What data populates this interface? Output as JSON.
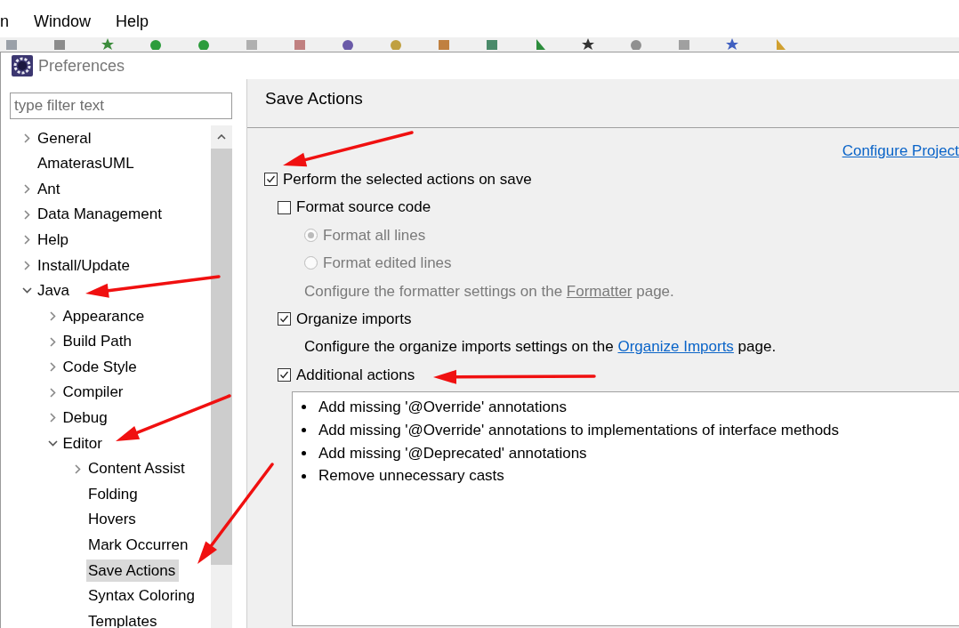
{
  "menu_bar": [
    "n",
    "Window",
    "Help"
  ],
  "dialog": {
    "title": "Preferences"
  },
  "filter": {
    "placeholder": "type filter text"
  },
  "tree": [
    {
      "label": "General",
      "kind": "folder",
      "expanded": false,
      "selected": false
    },
    {
      "label": "AmaterasUML",
      "kind": "leaf",
      "selected": false
    },
    {
      "label": "Ant",
      "kind": "folder",
      "expanded": false,
      "selected": false
    },
    {
      "label": "Data Management",
      "kind": "folder",
      "expanded": false,
      "selected": false
    },
    {
      "label": "Help",
      "kind": "folder",
      "expanded": false,
      "selected": false
    },
    {
      "label": "Install/Update",
      "kind": "folder",
      "expanded": false,
      "selected": false
    },
    {
      "label": "Java",
      "kind": "folder",
      "expanded": true,
      "selected": false,
      "children": [
        {
          "label": "Appearance",
          "kind": "folder",
          "expanded": false,
          "selected": false
        },
        {
          "label": "Build Path",
          "kind": "folder",
          "expanded": false,
          "selected": false
        },
        {
          "label": "Code Style",
          "kind": "folder",
          "expanded": false,
          "selected": false
        },
        {
          "label": "Compiler",
          "kind": "folder",
          "expanded": false,
          "selected": false
        },
        {
          "label": "Debug",
          "kind": "folder",
          "expanded": false,
          "selected": false
        },
        {
          "label": "Editor",
          "kind": "folder",
          "expanded": true,
          "selected": false,
          "children": [
            {
              "label": "Content Assist",
              "kind": "folder",
              "expanded": false,
              "selected": false
            },
            {
              "label": "Folding",
              "kind": "leaf",
              "selected": false
            },
            {
              "label": "Hovers",
              "kind": "leaf",
              "selected": false
            },
            {
              "label": "Mark Occurren",
              "kind": "leaf",
              "selected": false
            },
            {
              "label": "Save Actions",
              "kind": "leaf",
              "selected": true
            },
            {
              "label": "Syntax Coloring",
              "kind": "leaf",
              "selected": false
            },
            {
              "label": "Templates",
              "kind": "leaf",
              "selected": false
            }
          ]
        }
      ]
    }
  ],
  "page": {
    "title": "Save Actions",
    "link": "Configure Project",
    "options": [
      {
        "kind": "checkbox",
        "label": "Perform the selected actions on save",
        "checked": true,
        "children": [
          {
            "kind": "checkbox",
            "label": "Format source code",
            "checked": false,
            "children": [
              {
                "kind": "radio",
                "label": "Format all lines",
                "checked": true,
                "disabled": true
              },
              {
                "kind": "radio",
                "label": "Format edited lines",
                "checked": false,
                "disabled": true
              },
              {
                "kind": "note",
                "before": "Configure the formatter settings on the ",
                "link": "Formatter",
                "after": " page.",
                "disabled": true
              }
            ]
          },
          {
            "kind": "checkbox",
            "label": "Organize imports",
            "checked": true,
            "children": [
              {
                "kind": "note",
                "before": "Configure the organize imports settings on the ",
                "link": "Organize Imports",
                "after": " page.",
                "disabled": false
              }
            ]
          },
          {
            "kind": "checkbox",
            "label": "Additional actions",
            "checked": true
          }
        ]
      }
    ],
    "actions": [
      "Add missing '@Override' annotations",
      "Add missing '@Override' annotations to implementations of interface methods",
      "Add missing '@Deprecated' annotations",
      "Remove unnecessary casts"
    ]
  }
}
